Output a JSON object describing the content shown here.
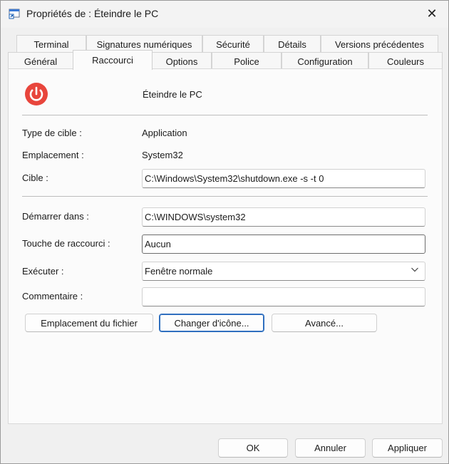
{
  "window": {
    "title": "Propriétés de : Éteindre le PC",
    "close_glyph": "✕"
  },
  "tabs_row1": [
    {
      "label": "Terminal"
    },
    {
      "label": "Signatures numériques"
    },
    {
      "label": "Sécurité"
    },
    {
      "label": "Détails"
    },
    {
      "label": "Versions précédentes"
    }
  ],
  "tabs_row2": [
    {
      "label": "Général"
    },
    {
      "label": "Raccourci",
      "active": true
    },
    {
      "label": "Options"
    },
    {
      "label": "Police"
    },
    {
      "label": "Configuration"
    },
    {
      "label": "Couleurs"
    }
  ],
  "shortcut": {
    "icon": "power-icon",
    "icon_color": "#e8453c",
    "name": "Éteindre le PC"
  },
  "fields": {
    "target_type_label": "Type de cible :",
    "target_type_value": "Application",
    "location_label": "Emplacement :",
    "location_value": "System32",
    "target_label": "Cible :",
    "target_value": "C:\\Windows\\System32\\shutdown.exe -s -t 0",
    "start_in_label": "Démarrer dans :",
    "start_in_value": "C:\\WINDOWS\\system32",
    "hotkey_label": "Touche de raccourci :",
    "hotkey_value": "Aucun",
    "run_label": "Exécuter :",
    "run_value": "Fenêtre normale",
    "comment_label": "Commentaire :",
    "comment_value": ""
  },
  "actions": {
    "open_location": "Emplacement du fichier",
    "change_icon": "Changer d'icône...",
    "advanced": "Avancé..."
  },
  "footer": {
    "ok": "OK",
    "cancel": "Annuler",
    "apply": "Appliquer"
  }
}
